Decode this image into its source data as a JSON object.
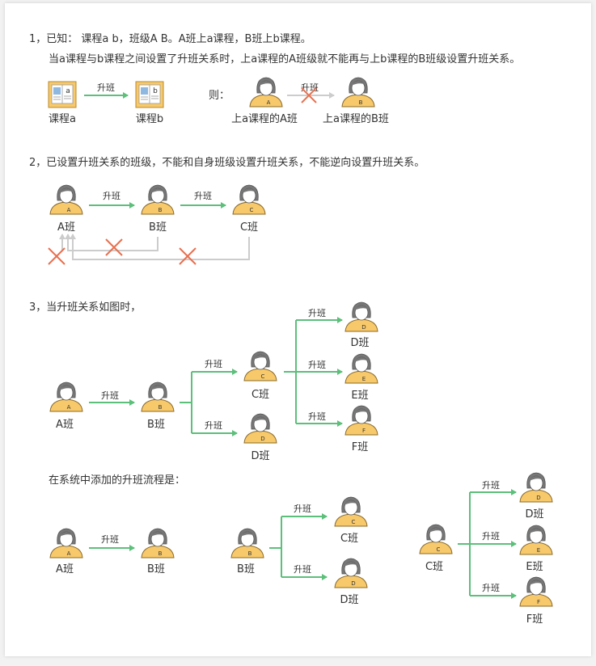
{
  "rule1": {
    "line1": "1，已知： 课程a b，班级A B。A班上a课程，B班上b课程。",
    "line2": "当a课程与b课程之间设置了升班关系时，上a课程的A班级就不能再与上b课程的B班级设置升班关系。",
    "then": "则：",
    "book_a_label": "课程a",
    "book_b_label": "课程b",
    "book_a_letter": "a",
    "book_b_letter": "b",
    "class_a_label": "上a课程的A班",
    "class_b_label": "上a课程的B班"
  },
  "rule2": {
    "text": "2，已设置升班关系的班级，不能和自身班级设置升班关系，不能逆向设置升班关系。",
    "a_label": "A班",
    "b_label": "B班",
    "c_label": "C班"
  },
  "rule3": {
    "text": "3，当升班关系如图时，",
    "a_label": "A班",
    "b_label": "B班",
    "c_label": "C班",
    "d_label": "D班",
    "d2_label": "D班",
    "e_label": "E班",
    "f_label": "F班"
  },
  "flow": {
    "text": "在系统中添加的升班流程是：",
    "s1_a": "A班",
    "s1_b": "B班",
    "s2_b": "B班",
    "s2_c": "C班",
    "s2_d": "D班",
    "s3_c": "C班",
    "s3_d": "D班",
    "s3_e": "E班",
    "s3_f": "F班"
  },
  "arrow_label": "升班",
  "badges": {
    "a": "A",
    "b": "B",
    "c": "C",
    "d": "D",
    "e": "E",
    "f": "F"
  },
  "colors": {
    "arrow": "#5cbf7a",
    "cross": "#e8704f",
    "back_arrow": "#cccccc",
    "person_body": "#f7c96a",
    "person_hair": "#777777"
  }
}
